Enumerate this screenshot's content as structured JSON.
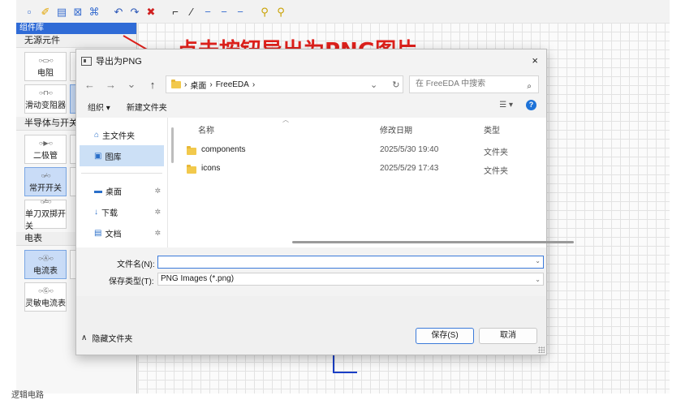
{
  "app": {
    "toolbar_icons": [
      "new-icon",
      "pencil-icon",
      "save-icon",
      "export-icon",
      "fit-icon",
      "undo-icon",
      "redo-icon",
      "delete-icon",
      "orthogonal-line-icon",
      "diagonal-line-icon",
      "dash-line-icon",
      "dash-line-2-icon",
      "dash-line-3-icon",
      "zoom-in-icon",
      "zoom-out-icon"
    ],
    "panel_header": "组件库",
    "sections": [
      {
        "title": "无源元件",
        "items": [
          {
            "label": "电阻",
            "sym": "○-▭-○"
          },
          {
            "label": "可",
            "sym": "○-▭-○"
          },
          {
            "label": "滑动变阻器",
            "sym": "○-⊓-○"
          },
          {
            "label": "电感",
            "sym": "○⌒⌒○",
            "selected": true
          }
        ]
      },
      {
        "title": "半导体与开关",
        "items": [
          {
            "label": "二极管",
            "sym": "○-▶-○"
          },
          {
            "label": "三",
            "sym": "○-▷-○"
          },
          {
            "label": "常开开关",
            "sym": "○-∕-○",
            "selected": true
          },
          {
            "label": "常",
            "sym": "○-∕-○"
          },
          {
            "label": "单刀双掷开关",
            "sym": "○-⁄=○"
          }
        ]
      },
      {
        "title": "电表",
        "items": [
          {
            "label": "电流表",
            "sym": "○-Ⓐ-○",
            "selected": true
          },
          {
            "label": "电",
            "sym": "○-Ⓥ-○"
          },
          {
            "label": "灵敏电流表",
            "sym": "○-Ⓖ-○"
          }
        ]
      }
    ],
    "bottom_label": "逻辑电路"
  },
  "annotation": "点击按钮导出为PNG图片",
  "dialog": {
    "title": "导出为PNG",
    "close": "×",
    "nav": {
      "back": "←",
      "forward": "→",
      "down": "⌄",
      "up": "↑"
    },
    "address": {
      "sep": "›",
      "segments": [
        "桌面",
        "FreeEDA"
      ],
      "trail": "›",
      "dropdown": "⌄",
      "refresh": "↻"
    },
    "search_placeholder": "在 FreeEDA 中搜索",
    "search_icon": "⌕",
    "commands": {
      "organize": "组织 ▾",
      "new_folder": "新建文件夹",
      "view": "☰ ▾",
      "help": "?"
    },
    "nav_pane": {
      "quick": [
        {
          "label": "主文件夹",
          "icon": "⌂"
        },
        {
          "label": "图库",
          "icon": "▣",
          "selected": true
        }
      ],
      "pinned": [
        {
          "label": "桌面",
          "icon": "▬",
          "pin": "✲"
        },
        {
          "label": "下载",
          "icon": "↓",
          "pin": "✲"
        },
        {
          "label": "文档",
          "icon": "▤",
          "pin": "✲"
        }
      ]
    },
    "columns": {
      "name": "名称",
      "modified": "修改日期",
      "type": "类型",
      "sort": "︿"
    },
    "files": [
      {
        "name": "components",
        "modified": "2025/5/30 19:40",
        "type": "文件夹"
      },
      {
        "name": "icons",
        "modified": "2025/5/29 17:43",
        "type": "文件夹"
      }
    ],
    "filename_label": "文件名(N):",
    "filename_value": "",
    "filetype_label": "保存类型(T):",
    "filetype_value": "PNG Images (*.png)",
    "dd": "⌄",
    "hide_folders": "隐藏文件夹",
    "hide_caret": "∧",
    "save": "保存(S)",
    "cancel": "取消"
  }
}
